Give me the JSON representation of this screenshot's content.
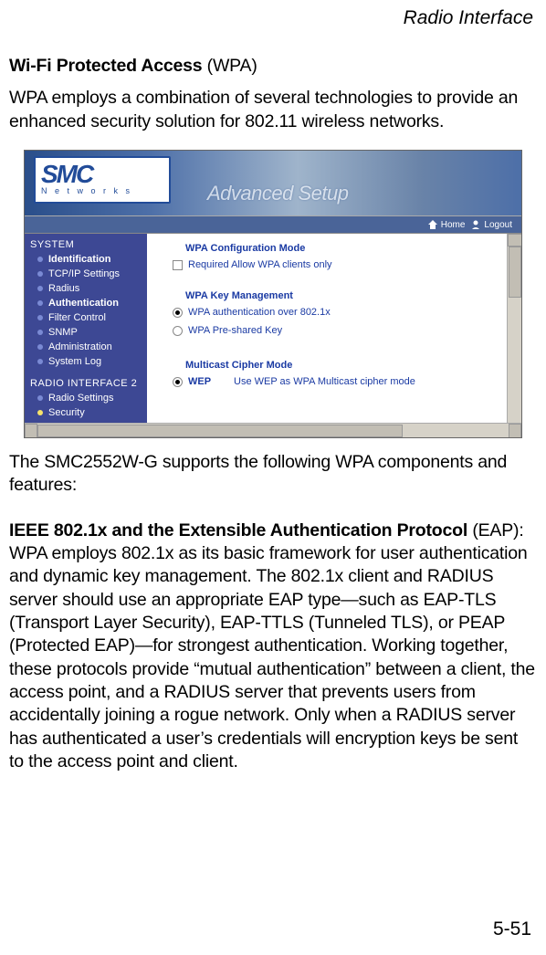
{
  "header": "Radio Interface",
  "intro": {
    "title_bold": "Wi-Fi Protected Access",
    "title_paren": " (WPA)",
    "body": "WPA employs a combination of several technologies to provide an enhanced security solution for 802.11 wireless networks."
  },
  "screenshot": {
    "logo_main": "SMC",
    "logo_sub": "N e t w o r k s",
    "adv_setup": "Advanced Setup",
    "home": "Home",
    "logout": "Logout",
    "sidebar": {
      "sys_head": "SYSTEM",
      "items": [
        "Identification",
        "TCP/IP Settings",
        "Radius",
        "Authentication",
        "Filter Control",
        "SNMP",
        "Administration",
        "System Log"
      ],
      "radio_head": "RADIO INTERFACE 2",
      "radio_items": [
        "Radio Settings",
        "Security"
      ]
    },
    "content": {
      "sec1": "WPA Configuration Mode",
      "opt1": "Required   Allow WPA clients only",
      "sec2": "WPA Key Management",
      "opt2a": "WPA authentication over 802.1x",
      "opt2b": "WPA Pre-shared Key",
      "sec3": "Multicast Cipher Mode",
      "opt3a_label": "WEP",
      "opt3a_desc": "Use WEP as WPA Multicast cipher mode"
    }
  },
  "post1": "The SMC2552W-G supports the following WPA components and features:",
  "post2": {
    "bold": "IEEE 802.1x and the Extensible Authentication Protocol",
    "paren": " (EAP): ",
    "body": "WPA employs 802.1x as its basic framework for user authentication and dynamic key management. The 802.1x client and RADIUS server should use an appropriate EAP type—such as EAP-TLS (Transport Layer Security), EAP-TTLS (Tunneled TLS), or PEAP (Protected EAP)—for strongest authentication. Working together, these protocols provide “mutual authentication” between a client, the access point, and a RADIUS server that prevents users from accidentally joining a rogue network. Only when a RADIUS server has authenticated a user’s credentials will encryption keys be sent to the access point and client."
  },
  "page_num": "5-51"
}
